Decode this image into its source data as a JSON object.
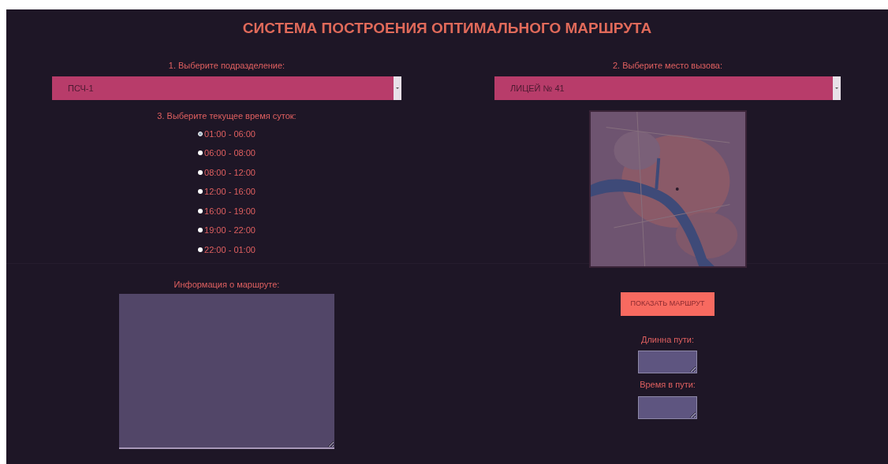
{
  "title": "СИСТЕМА ПОСТРОЕНИЯ ОПТИМАЛЬНОГО МАРШРУТА",
  "unit": {
    "label": "1. Выберите подразделение:",
    "value": "ПСЧ-1"
  },
  "place": {
    "label": "2. Выберите место вызова:",
    "value": "ЛИЦЕЙ № 41"
  },
  "time": {
    "label": "3. Выберите текущее время суток:",
    "options": [
      {
        "label": "01:00 - 06:00",
        "selected": true
      },
      {
        "label": "06:00 - 08:00",
        "selected": false
      },
      {
        "label": "08:00 - 12:00",
        "selected": false
      },
      {
        "label": "12:00 - 16:00",
        "selected": false
      },
      {
        "label": "16:00 - 19:00",
        "selected": false
      },
      {
        "label": "19:00 - 22:00",
        "selected": false
      },
      {
        "label": "22:00 - 01:00",
        "selected": false
      }
    ]
  },
  "info": {
    "label": "Информация о маршруте:"
  },
  "show_button": "ПОКАЗАТЬ МАРШРУТ",
  "length": {
    "label": "Длинна пути:"
  },
  "duration": {
    "label": "Время в пути:"
  }
}
